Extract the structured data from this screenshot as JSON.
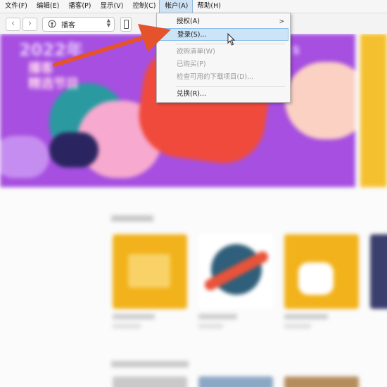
{
  "menubar": {
    "items": [
      "文件(F)",
      "编辑(E)",
      "播客(P)",
      "显示(V)",
      "控制(C)",
      "帐户(A)",
      "帮助(H)"
    ]
  },
  "toolbar": {
    "back_icon": "chevron-left-icon",
    "forward_icon": "chevron-right-icon",
    "media_selector": "播客",
    "device_icon": "iphone-icon"
  },
  "account_menu": {
    "items": [
      {
        "label": "授权(A)",
        "submenu": ">"
      },
      {
        "label": "登录(S)..."
      },
      {
        "label": "欲购清单(W)"
      },
      {
        "label": "已购买(P)"
      },
      {
        "label": "检查可用的下载项目(D)..."
      },
      {
        "label": "兑换(R)..."
      }
    ]
  },
  "banner": {
    "title": "2022年",
    "subtitle_lines": [
      "播客",
      "精选节目"
    ],
    "side_letter": "S"
  },
  "colors": {
    "banner_purple": "#a64fe0",
    "annotation_arrow": "#e5532d",
    "menu_highlight": "#cce4f7"
  }
}
